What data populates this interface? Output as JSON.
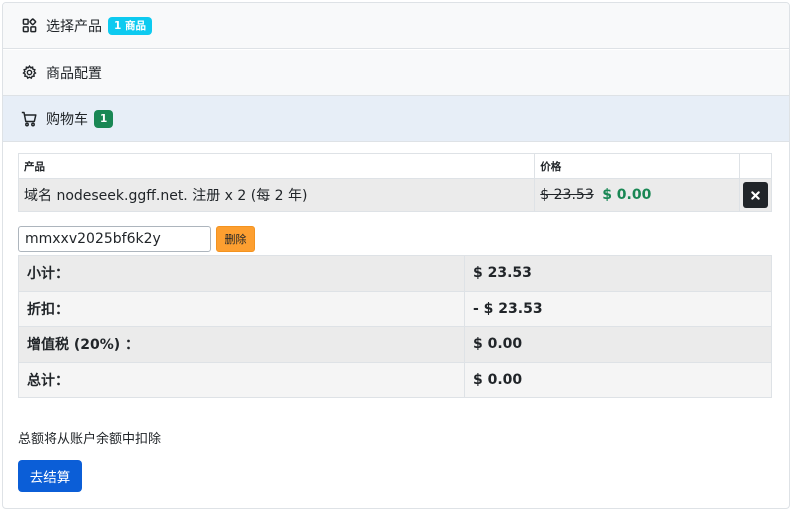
{
  "steps": [
    {
      "label": "选择产品",
      "badge": "1 商品",
      "icon": "grid-icon"
    },
    {
      "label": "商品配置",
      "icon": "gear-icon"
    },
    {
      "label": "购物车",
      "badge": "1",
      "icon": "cart-icon"
    }
  ],
  "cart": {
    "headers": {
      "product": "产品",
      "price": "价格"
    },
    "item": {
      "description": "域名 nodeseek.ggff.net. 注册 x 2 (每 2 年)",
      "old_price": "$ 23.53",
      "new_price": "$ 0.00"
    }
  },
  "promo": {
    "code": "mmxxv2025bf6k2y",
    "remove_label": "删除"
  },
  "totals": [
    {
      "label": "小计：",
      "value": "$ 23.53"
    },
    {
      "label": "折扣：",
      "value": "- $ 23.53"
    },
    {
      "label": "增值税 (20%) ：",
      "value": "$ 0.00"
    },
    {
      "label": "总计：",
      "value": "$ 0.00"
    }
  ],
  "note": "总额将从账户余额中扣除",
  "checkout_label": "去结算",
  "colors": {
    "info": "#0dcaf0",
    "success": "#198754",
    "warning": "#fd9f30",
    "primary": "#0b5ed7"
  }
}
